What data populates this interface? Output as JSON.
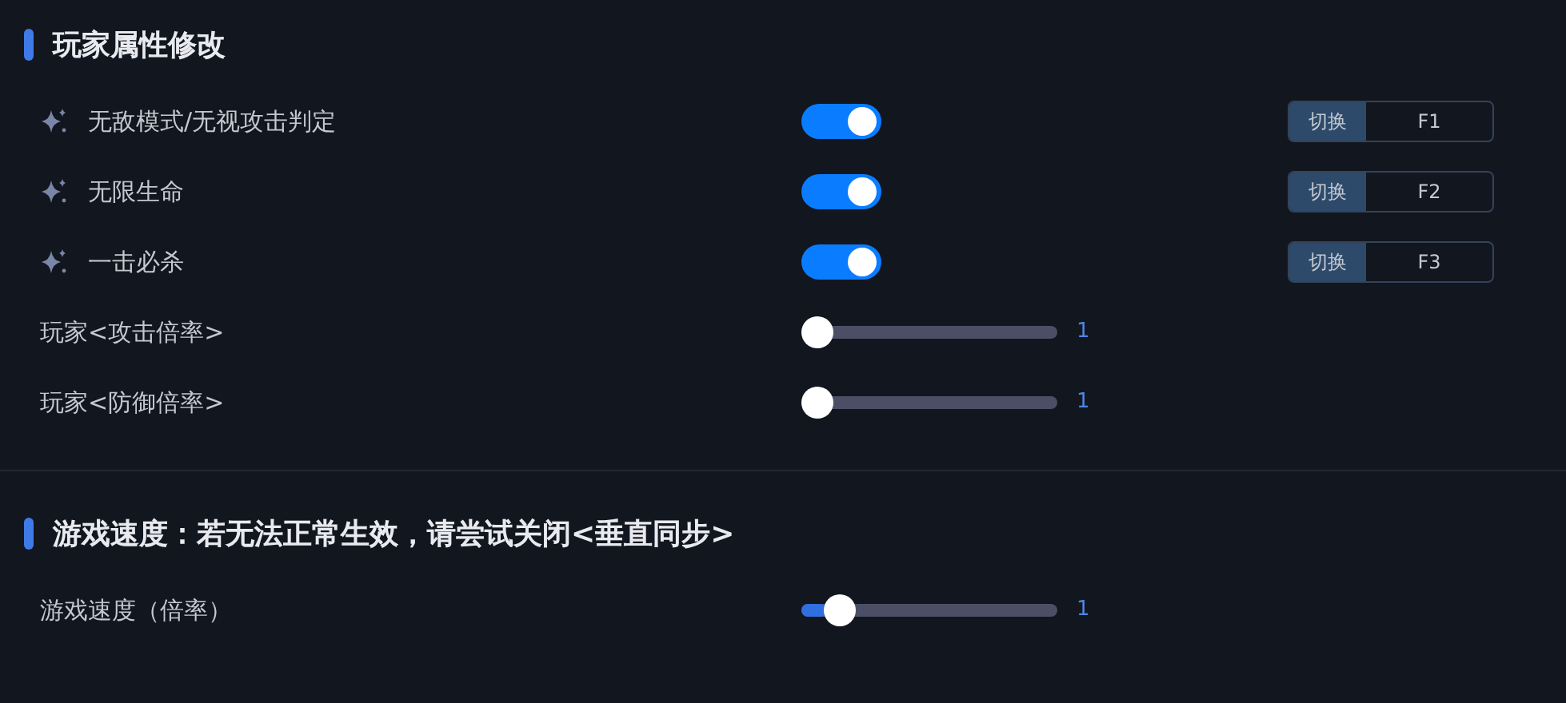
{
  "sections": [
    {
      "title": "玩家属性修改",
      "rows": [
        {
          "kind": "toggle",
          "label": "无敌模式/无视攻击判定",
          "on": true,
          "hotkey": {
            "action": "切换",
            "key": "F1"
          }
        },
        {
          "kind": "toggle",
          "label": "无限生命",
          "on": true,
          "hotkey": {
            "action": "切换",
            "key": "F2"
          }
        },
        {
          "kind": "toggle",
          "label": "一击必杀",
          "on": true,
          "hotkey": {
            "action": "切换",
            "key": "F3"
          }
        },
        {
          "kind": "slider",
          "label": "玩家<攻击倍率>",
          "level": 0,
          "reading": "1"
        },
        {
          "kind": "slider",
          "label": "玩家<防御倍率>",
          "level": 0,
          "reading": "1"
        }
      ]
    },
    {
      "title": "游戏速度：若无法正常生效，请尝试关闭<垂直同步>",
      "rows": [
        {
          "kind": "slider",
          "label": "游戏速度（倍率）",
          "level": 0.1,
          "reading": "1"
        }
      ]
    }
  ]
}
